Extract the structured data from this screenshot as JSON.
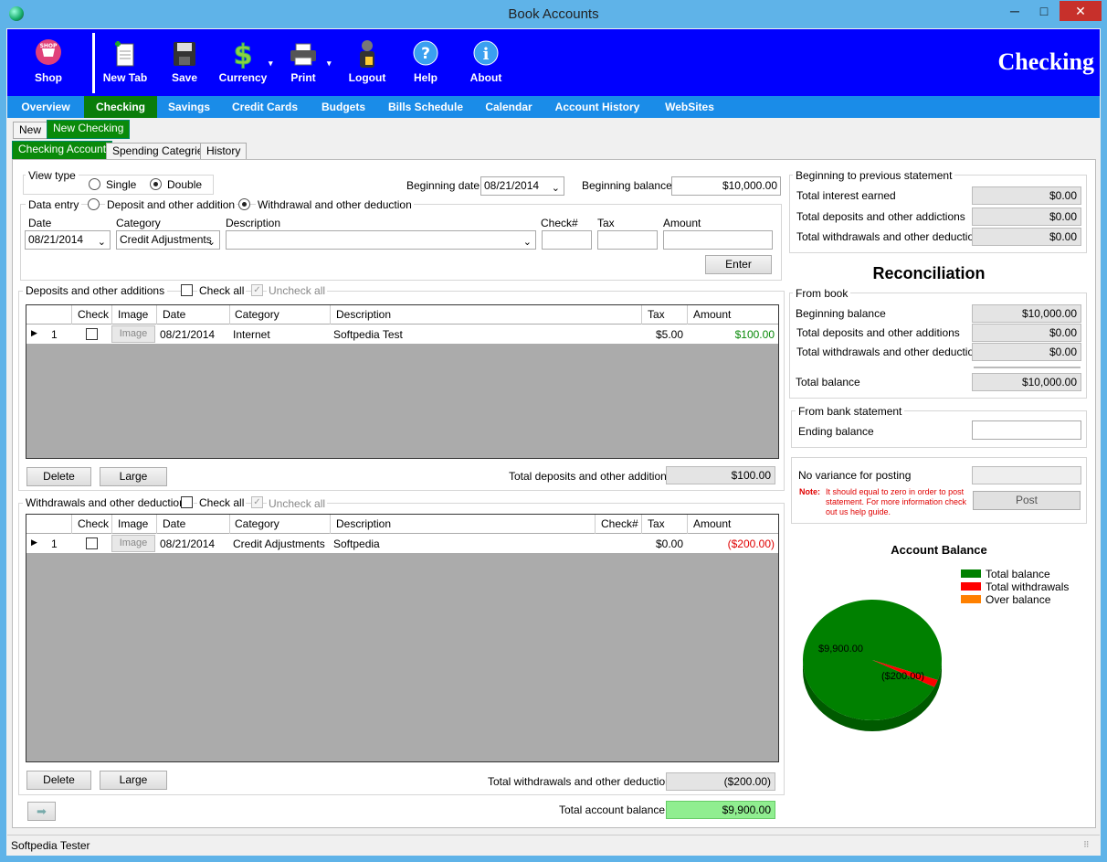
{
  "window": {
    "title": "Book Accounts",
    "minimize": "─",
    "maximize": "□",
    "close": "✕"
  },
  "toolbar": {
    "items": [
      {
        "label": "Shop",
        "icon": "shop-icon"
      },
      {
        "label": "New Tab",
        "icon": "new-tab-icon"
      },
      {
        "label": "Save",
        "icon": "save-icon"
      },
      {
        "label": "Currency",
        "icon": "currency-icon"
      },
      {
        "label": "Print",
        "icon": "print-icon"
      },
      {
        "label": "Logout",
        "icon": "logout-icon"
      },
      {
        "label": "Help",
        "icon": "help-icon"
      },
      {
        "label": "About",
        "icon": "about-icon"
      }
    ],
    "heading": "Checking",
    "colors": {
      "bar": "#0000ff",
      "nav": "#1a8ce8",
      "active": "#0a7d0a"
    }
  },
  "nav": [
    "Overview",
    "Checking",
    "Savings",
    "Credit Cards",
    "Budgets",
    "Bills Schedule",
    "Calendar",
    "Account History",
    "WebSites"
  ],
  "subtabs": [
    "New",
    "New Checking"
  ],
  "tabs": [
    "Checking Account",
    "Spending Categries",
    "History"
  ],
  "view_type": {
    "label": "View type",
    "single": "Single",
    "double": "Double",
    "selected": "Double"
  },
  "beginning_date": {
    "label": "Beginning date",
    "value": "08/21/2014"
  },
  "beginning_balance": {
    "label": "Beginning balance",
    "value": "$10,000.00"
  },
  "data_entry": {
    "label": "Data entry",
    "deposit": "Deposit and other addition",
    "withdrawal": "Withdrawal and other deduction",
    "selected": "Withdrawal",
    "date_label": "Date",
    "date_value": "08/21/2014",
    "category_label": "Category",
    "category_value": "Credit Adjustments",
    "description_label": "Description",
    "check_label": "Check#",
    "tax_label": "Tax",
    "amount_label": "Amount",
    "enter": "Enter"
  },
  "columns": {
    "check": "Check",
    "image": "Image",
    "date": "Date",
    "category": "Category",
    "description": "Description",
    "checknum": "Check#",
    "tax": "Tax",
    "amount": "Amount"
  },
  "deposits": {
    "title": "Deposits and other additions",
    "check_all": "Check all",
    "uncheck_all": "Uncheck all",
    "rows": [
      {
        "num": "1",
        "image": "Image",
        "date": "08/21/2014",
        "category": "Internet",
        "description": "Softpedia Test",
        "tax": "$5.00",
        "amount": "$100.00"
      }
    ],
    "delete": "Delete",
    "large": "Large",
    "total_label": "Total deposits  and other additions",
    "total": "$100.00"
  },
  "withdrawals": {
    "title": "Withdrawals  and other deductions",
    "check_all": "Check all",
    "uncheck_all": "Uncheck all",
    "rows": [
      {
        "num": "1",
        "image": "Image",
        "date": "08/21/2014",
        "category": "Credit Adjustments",
        "description": "Softpedia",
        "checknum": "",
        "tax": "$0.00",
        "amount": "($200.00)"
      }
    ],
    "delete": "Delete",
    "large": "Large",
    "total_label": "Total withdrawals and other deductions",
    "total": "($200.00)"
  },
  "account_balance": {
    "label": "Total account balance",
    "value": "$9,900.00"
  },
  "prev_statement": {
    "title": "Beginning to previous statement",
    "interest_label": "Total interest earned",
    "interest": "$0.00",
    "deposits_label": "Total deposits and other addictions",
    "deposits": "$0.00",
    "withdrawals_label": "Total withdrawals and other deductions",
    "withdrawals": "$0.00"
  },
  "reconciliation": {
    "title": "Reconciliation",
    "from_book": "From book",
    "beginning_label": "Beginning balance",
    "beginning": "$10,000.00",
    "deposits_label": "Total deposits and other additions",
    "deposits": "$0.00",
    "withdrawals_label": "Total withdrawals and other deductions",
    "withdrawals": "$0.00",
    "total_label": "Total balance",
    "total": "$10,000.00",
    "from_bank": "From bank statement",
    "ending_label": "Ending balance",
    "ending": "",
    "variance_label": "No variance for posting",
    "variance": "",
    "note_label": "Note:",
    "note_text": "It should equal to zero in order to post statement. For more information check out us help guide.",
    "post": "Post"
  },
  "chart_data": {
    "type": "pie",
    "title": "Account Balance",
    "legend": [
      "Total balance",
      "Total withdrawals",
      "Over balance"
    ],
    "legend_placement": "top-right",
    "slices": [
      {
        "name": "Total balance",
        "label": "$9,900.00",
        "value": 9900,
        "color": "#008000"
      },
      {
        "name": "Total withdrawals",
        "label": "($200.00)",
        "value": 200,
        "color": "#ff0000"
      },
      {
        "name": "Over balance",
        "label": "",
        "value": 0,
        "color": "#ff8000"
      }
    ]
  },
  "statusbar": {
    "user": "Softpedia Tester"
  }
}
